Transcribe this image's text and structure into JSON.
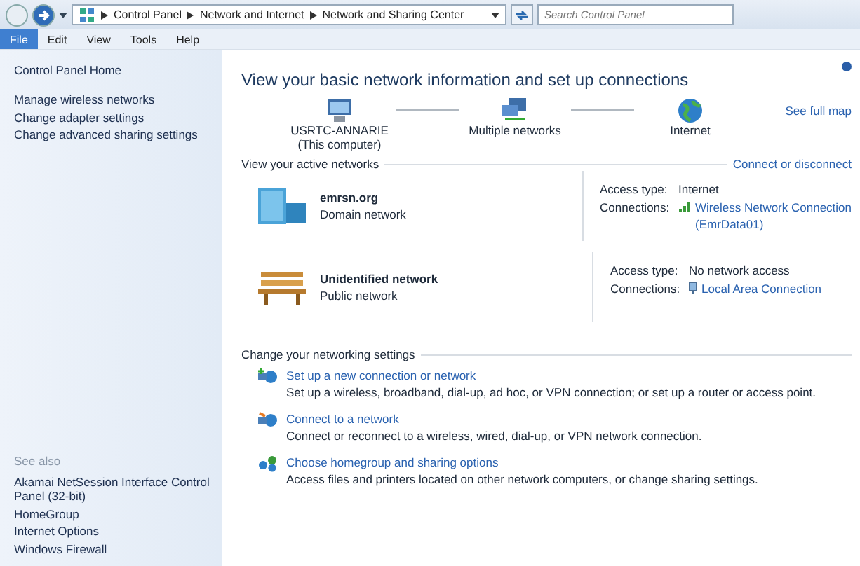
{
  "address_bar": {
    "breadcrumbs": [
      "Control Panel",
      "Network and Internet",
      "Network and Sharing Center"
    ],
    "search": {
      "placeholder": "Search Control Panel"
    }
  },
  "menu": [
    {
      "label": "File",
      "selected": true
    },
    {
      "label": "Edit",
      "selected": false
    },
    {
      "label": "View",
      "selected": false
    },
    {
      "label": "Tools",
      "selected": false
    },
    {
      "label": "Help",
      "selected": false
    }
  ],
  "sidebar": {
    "home": "Control Panel Home",
    "items": [
      "Manage wireless networks",
      "Change adapter settings",
      "Change advanced sharing settings"
    ],
    "see_also_heading": "See also",
    "see_also": [
      "Akamai NetSession Interface Control Panel (32-bit)",
      "HomeGroup",
      "Internet Options",
      "Windows Firewall"
    ]
  },
  "main": {
    "title": "View your basic network information and set up connections",
    "see_full_map": "See full map",
    "map_nodes": [
      {
        "kind": "computer",
        "label": "USRTC-ANNARIE",
        "sublabel": "(This computer)"
      },
      {
        "kind": "networks",
        "label": "Multiple networks"
      },
      {
        "kind": "internet",
        "label": "Internet"
      }
    ],
    "active_heading": "View your active networks",
    "connect_link": "Connect or disconnect",
    "networks": [
      {
        "kind": "domain",
        "name": "emrsn.org",
        "type": "Domain network",
        "access_label": "Access type:",
        "access": "Internet",
        "connections_label": "Connections:",
        "connection": {
          "kind": "wireless",
          "label": "Wireless Network Connection",
          "detail": "(EmrData01)"
        }
      },
      {
        "kind": "public",
        "name": "Unidentified network",
        "type": "Public network",
        "access_label": "Access type:",
        "access": "No network access",
        "connections_label": "Connections:",
        "connection": {
          "kind": "wired",
          "label": "Local Area Connection"
        }
      }
    ],
    "settings_heading": "Change your networking settings",
    "tasks": [
      {
        "kind": "new",
        "link": "Set up a new connection or network",
        "description": "Set up a wireless, broadband, dial-up, ad hoc, or VPN connection; or set up a router or access point."
      },
      {
        "kind": "connect",
        "link": "Connect to a network",
        "description": "Connect or reconnect to a wireless, wired, dial-up, or VPN network connection."
      },
      {
        "kind": "homegroup",
        "link": "Choose homegroup and sharing options",
        "description": "Access files and printers located on other network computers, or change sharing settings."
      }
    ]
  }
}
